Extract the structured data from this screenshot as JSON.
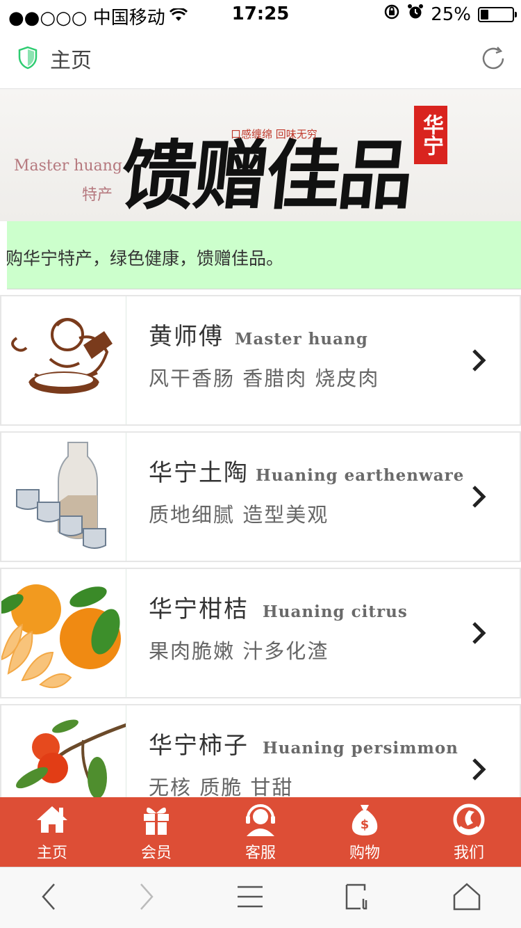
{
  "status_bar": {
    "carrier": "●●○○○ 中国移动",
    "time": "17:25",
    "battery": "25%",
    "battery_level": 0.25
  },
  "header": {
    "title": "主页"
  },
  "banner": {
    "en_text": "Master huang",
    "cn_small": "特产",
    "main_text": "馈赠佳品",
    "slogan": "口感缠绵 回味无穷",
    "seal_text": "华宁"
  },
  "notice": {
    "text": "购华宁特产，绿色健康，馈赠佳品。"
  },
  "products": [
    {
      "name": "黄师傅",
      "en": "Master huang",
      "desc": "风干香肠  香腊肉  烧皮肉",
      "icon": "chef-logo-image"
    },
    {
      "name": "华宁土陶",
      "en": "Huaning earthenware",
      "desc": "质地细腻  造型美观",
      "icon": "pottery-image"
    },
    {
      "name": "华宁柑桔",
      "en": "Huaning citrus",
      "desc": "果肉脆嫩  汁多化渣",
      "icon": "citrus-image"
    },
    {
      "name": "华宁柿子",
      "en": "Huaning persimmon",
      "desc": "无核  质脆  甘甜",
      "icon": "persimmon-image"
    }
  ],
  "tabbar": {
    "items": [
      {
        "label": "主页",
        "icon": "home-icon"
      },
      {
        "label": "会员",
        "icon": "gift-icon"
      },
      {
        "label": "客服",
        "icon": "support-icon"
      },
      {
        "label": "购物",
        "icon": "money-bag-icon"
      },
      {
        "label": "我们",
        "icon": "about-icon"
      }
    ]
  },
  "colors": {
    "tabbar": "#dd4e36",
    "notice_bg": "#ccffcc",
    "shield": "#2ecc71"
  }
}
